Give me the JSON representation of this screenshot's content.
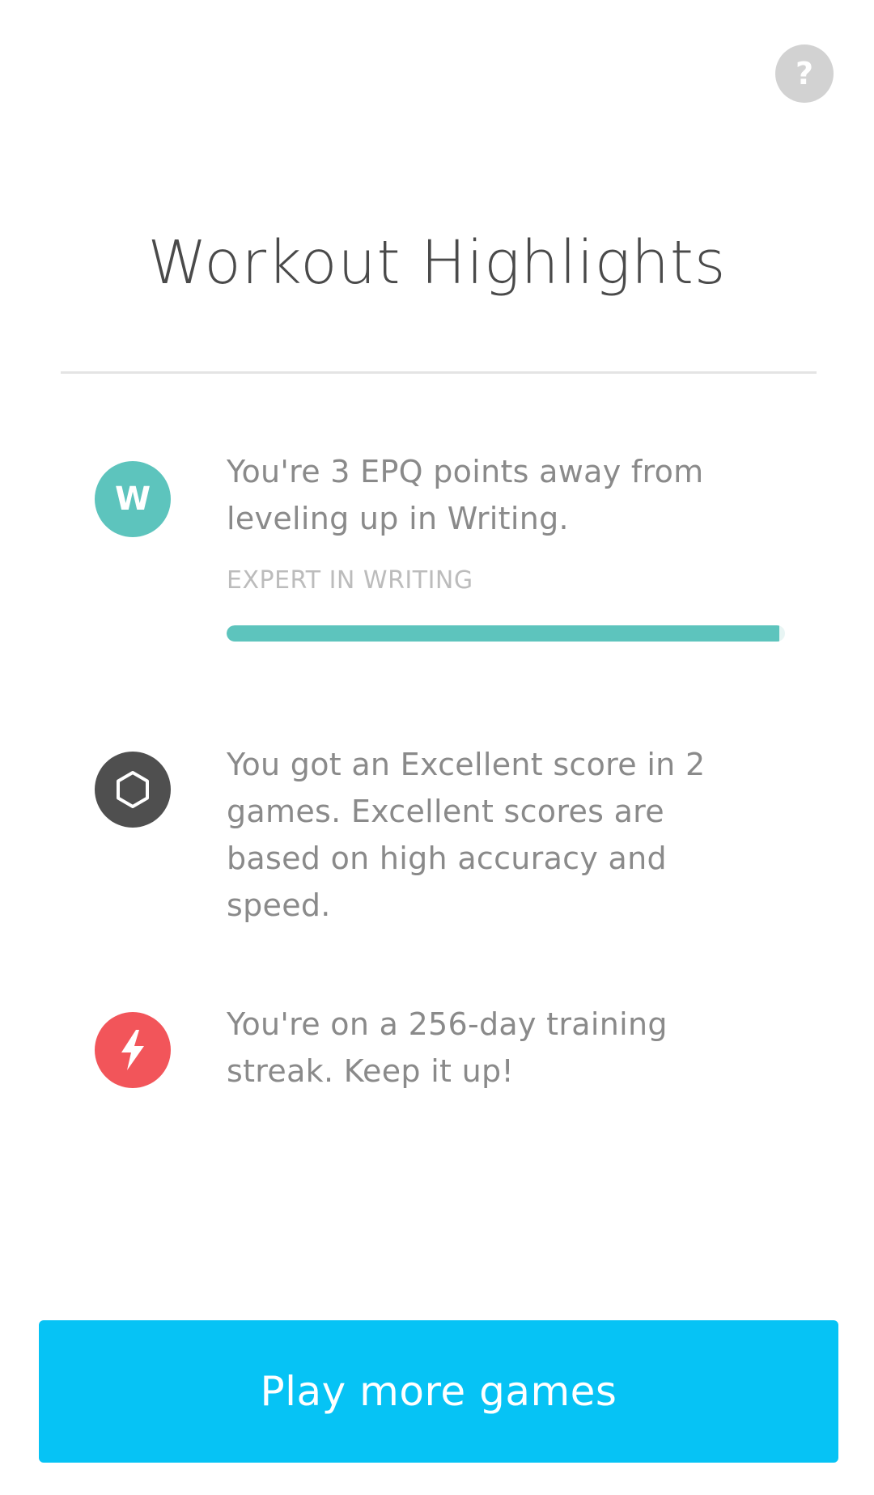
{
  "header": {
    "help_label": "?",
    "help_icon": "question-mark-icon"
  },
  "title": "Workout Highlights",
  "highlights": [
    {
      "icon": "writing-badge-icon",
      "icon_letter": "W",
      "icon_color": "#5dc4bd",
      "text": "You're 3 EPQ points away from leveling up in Writing.",
      "level_label": "EXPERT IN WRITING",
      "progress_fraction": 0.99
    },
    {
      "icon": "hexagon-icon",
      "icon_color": "#4f4f4f",
      "text": "You got an Excellent score in 2 games. Excellent scores are based on high accuracy and speed."
    },
    {
      "icon": "lightning-bolt-icon",
      "icon_color": "#f2555a",
      "text": "You're on a 256-day training streak. Keep it up!"
    }
  ],
  "footer": {
    "button_label": "Play more games",
    "button_color": "#06c3f5"
  }
}
